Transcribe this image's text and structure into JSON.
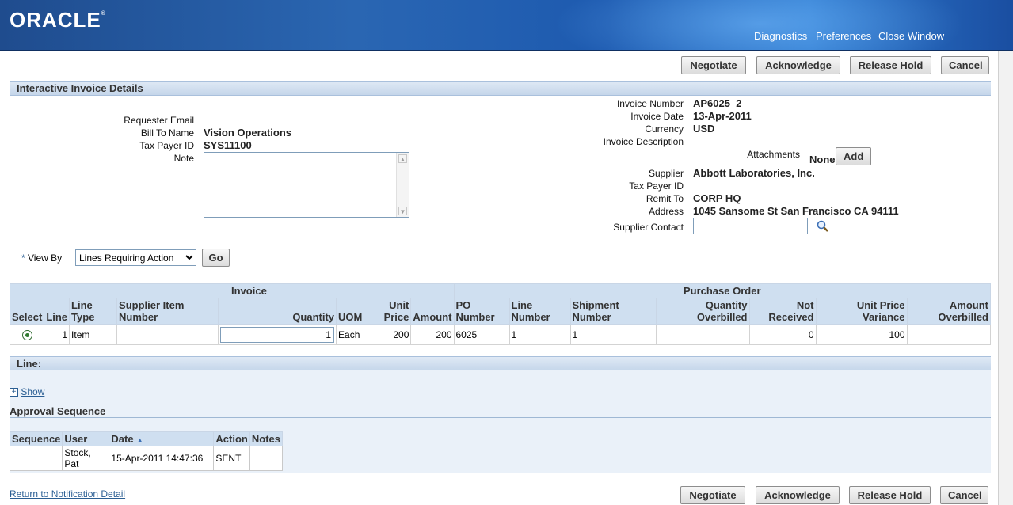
{
  "header": {
    "logo": "ORACLE",
    "global_links": [
      "Diagnostics",
      "Preferences",
      "Close Window"
    ]
  },
  "actions": {
    "negotiate": "Negotiate",
    "acknowledge": "Acknowledge",
    "release_hold": "Release Hold",
    "cancel": "Cancel"
  },
  "section_title": "Interactive Invoice Details",
  "left_fields": {
    "requester_email_label": "Requester Email",
    "bill_to_name_label": "Bill To Name",
    "bill_to_name": "Vision Operations",
    "tax_payer_id_label": "Tax Payer ID",
    "tax_payer_id": "SYS11100",
    "note_label": "Note"
  },
  "right_fields": {
    "invoice_number_label": "Invoice Number",
    "invoice_number": "AP6025_2",
    "invoice_date_label": "Invoice Date",
    "invoice_date": "13-Apr-2011",
    "currency_label": "Currency",
    "currency": "USD",
    "invoice_description_label": "Invoice Description",
    "attachments_label": "Attachments",
    "attachments_value": "None",
    "add_button": "Add",
    "supplier_label": "Supplier",
    "supplier": "Abbott Laboratories, Inc.",
    "supplier_tax_payer_id_label": "Tax Payer ID",
    "remit_to_label": "Remit To",
    "remit_to": "CORP HQ",
    "address_label": "Address",
    "address": "1045 Sansome St San Francisco CA 94111",
    "supplier_contact_label": "Supplier Contact"
  },
  "view_by": {
    "required_mark": "*",
    "label": "View By",
    "selected": "Lines Requiring Action",
    "go_button": "Go"
  },
  "lines_table": {
    "group_invoice": "Invoice",
    "group_po": "Purchase Order",
    "columns": {
      "select": "Select",
      "line": "Line",
      "line_type": "Line Type",
      "supplier_item_number": "Supplier Item Number",
      "quantity": "Quantity",
      "uom": "UOM",
      "unit_price": "Unit Price",
      "amount": "Amount",
      "po_number": "PO Number",
      "po_line_number": "Line Number",
      "shipment_number": "Shipment Number",
      "quantity_overbilled": "Quantity Overbilled",
      "not_received": "Not Received",
      "unit_price_variance": "Unit Price Variance",
      "amount_overbilled": "Amount Overbilled"
    },
    "rows": [
      {
        "line": "1",
        "line_type": "Item",
        "supplier_item_number": "",
        "quantity": "1",
        "uom": "Each",
        "unit_price": "200",
        "amount": "200",
        "po_number": "6025",
        "po_line_number": "1",
        "shipment_number": "1",
        "quantity_overbilled": "",
        "not_received": "0",
        "unit_price_variance": "100",
        "amount_overbilled": ""
      }
    ]
  },
  "line_section": {
    "title": "Line:",
    "show_link": "Show"
  },
  "approval": {
    "title": "Approval Sequence",
    "columns": [
      "Sequence",
      "User",
      "Date",
      "Action",
      "Notes"
    ],
    "rows": [
      {
        "sequence": "",
        "user": "Stock, Pat",
        "date": "15-Apr-2011 14:47:36",
        "action": "SENT",
        "notes": ""
      }
    ]
  },
  "footer": {
    "return_link": "Return to Notification Detail"
  },
  "colors": {
    "header_blue": "#1f4c8e",
    "section_bar": "#cfdff0",
    "link": "#2a5e93"
  }
}
